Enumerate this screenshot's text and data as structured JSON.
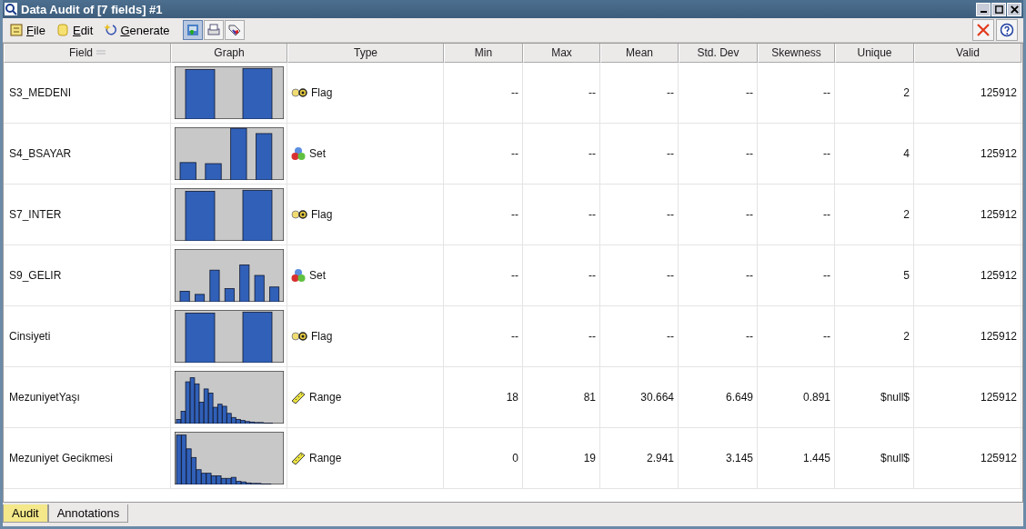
{
  "window": {
    "title": "Data Audit of [7 fields] #1"
  },
  "menu": [
    "File",
    "Edit",
    "Generate"
  ],
  "table": {
    "columns": [
      "Field",
      "Graph",
      "Type",
      "Min",
      "Max",
      "Mean",
      "Std. Dev",
      "Skewness",
      "Unique",
      "Valid"
    ],
    "rows": [
      {
        "field": "S3_MEDENI",
        "type": {
          "kind": "flag",
          "label": "Flag"
        },
        "min": "--",
        "max": "--",
        "mean": "--",
        "std_dev": "--",
        "skewness": "--",
        "unique": "2",
        "valid": "125912"
      },
      {
        "field": "S4_BSAYAR",
        "type": {
          "kind": "set",
          "label": "Set"
        },
        "min": "--",
        "max": "--",
        "mean": "--",
        "std_dev": "--",
        "skewness": "--",
        "unique": "4",
        "valid": "125912"
      },
      {
        "field": "S7_INTER",
        "type": {
          "kind": "flag",
          "label": "Flag"
        },
        "min": "--",
        "max": "--",
        "mean": "--",
        "std_dev": "--",
        "skewness": "--",
        "unique": "2",
        "valid": "125912"
      },
      {
        "field": "S9_GELIR",
        "type": {
          "kind": "set",
          "label": "Set"
        },
        "min": "--",
        "max": "--",
        "mean": "--",
        "std_dev": "--",
        "skewness": "--",
        "unique": "5",
        "valid": "125912"
      },
      {
        "field": "Cinsiyeti",
        "type": {
          "kind": "flag",
          "label": "Flag"
        },
        "min": "--",
        "max": "--",
        "mean": "--",
        "std_dev": "--",
        "skewness": "--",
        "unique": "2",
        "valid": "125912"
      },
      {
        "field": "MezuniyetYaşı",
        "type": {
          "kind": "range",
          "label": "Range"
        },
        "min": "18",
        "max": "81",
        "mean": "30.664",
        "std_dev": "6.649",
        "skewness": "0.891",
        "unique": "$null$",
        "valid": "125912"
      },
      {
        "field": "Mezuniyet Gecikmesi",
        "type": {
          "kind": "range",
          "label": "Range"
        },
        "min": "0",
        "max": "19",
        "mean": "2.941",
        "std_dev": "3.145",
        "skewness": "1.445",
        "unique": "$null$",
        "valid": "125912"
      }
    ]
  },
  "bottom_tabs": [
    {
      "label": "Audit",
      "selected": true
    },
    {
      "label": "Annotations",
      "selected": false
    }
  ]
}
